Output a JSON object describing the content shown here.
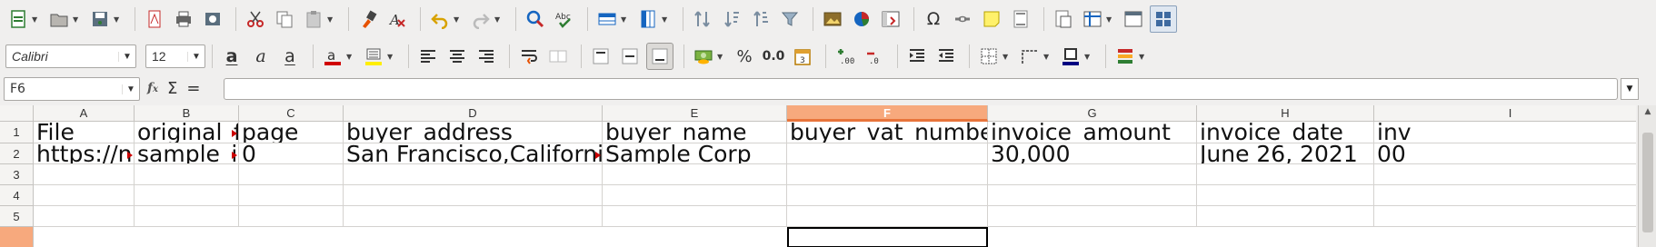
{
  "toolbar_standard": {
    "items": [
      "new",
      "open",
      "save",
      "export-pdf",
      "print",
      "print-preview",
      "cut",
      "copy",
      "paste",
      "clone-formatting",
      "clear-formatting",
      "undo",
      "redo",
      "find-replace",
      "spelling",
      "row",
      "column",
      "sort",
      "sort-ascending",
      "sort-descending",
      "autofilter",
      "image",
      "chart",
      "pivot-table",
      "special-character",
      "hyperlink",
      "comment",
      "headers-footers",
      "define-print-area",
      "freeze-rows-columns",
      "split-window",
      "show-draw-functions"
    ]
  },
  "formatting": {
    "font_name": "Calibri",
    "font_size": "12",
    "bold": "a",
    "italic": "a",
    "underline": "a",
    "font_color": "#d00000",
    "highlight_color": "#ffee00",
    "currency": "",
    "percent": "%",
    "decimal": "0.0",
    "border_color": "#000080"
  },
  "formula_bar": {
    "cell_ref": "F6",
    "func_sum": "Σ",
    "func_eq": "=",
    "value": ""
  },
  "grid": {
    "columns": [
      "A",
      "B",
      "C",
      "D",
      "E",
      "F",
      "G",
      "H",
      "I"
    ],
    "selected_column": "F",
    "rows": [
      "1",
      "2",
      "3",
      "4",
      "5"
    ],
    "cells": {
      "A1": "File",
      "B1": "original_f",
      "C1": "page",
      "D1": "buyer_address",
      "E1": "buyer_name",
      "F1": "buyer_vat_number",
      "G1": "invoice_amount",
      "H1": "invoice_date",
      "I1": "inv",
      "A2": "https://nn",
      "B2": "sample_in",
      "C2": "0",
      "D2": "San Francisco,California",
      "E2": "Sample Corp",
      "F2": "",
      "G2": "30,000",
      "H2": "June 26, 2021",
      "I2": "00"
    },
    "active_cell": "F6"
  }
}
